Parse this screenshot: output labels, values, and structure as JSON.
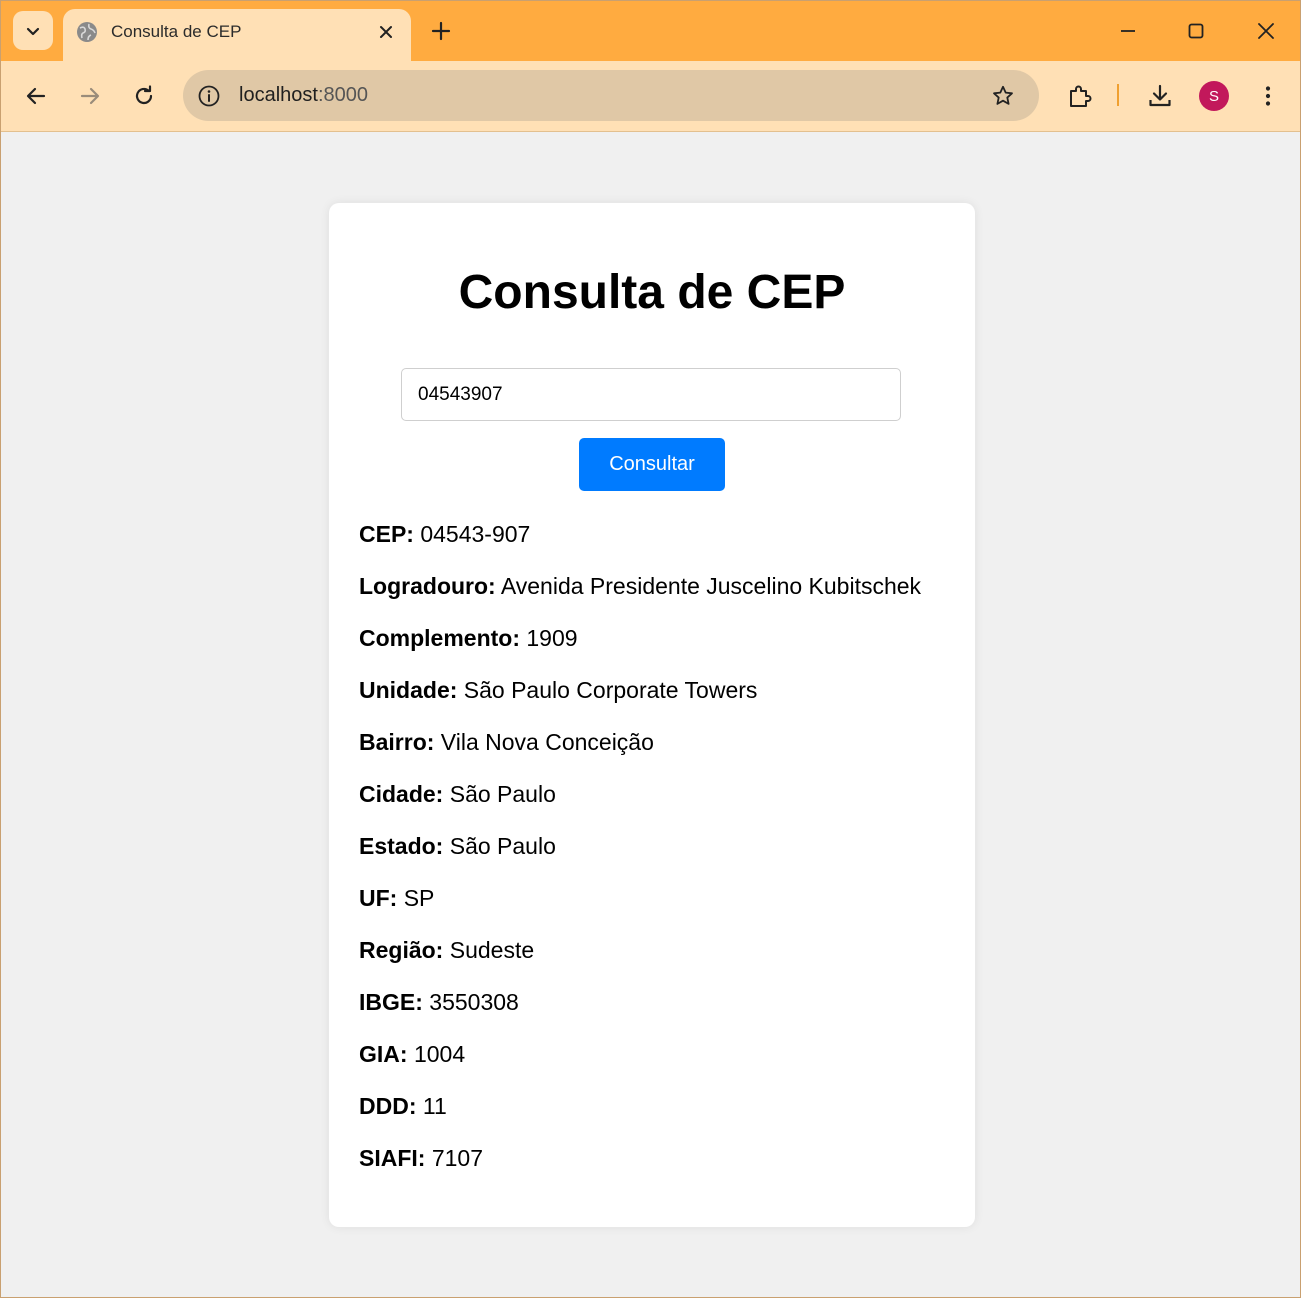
{
  "browser": {
    "tab": {
      "title": "Consulta de CEP"
    },
    "address_bar": {
      "host": "localhost",
      "port": ":8000"
    },
    "profile_initial": "S",
    "icons": {
      "tab_search": "chevron-down-icon",
      "favicon": "globe-icon",
      "tab_close": "close-icon",
      "new_tab": "plus-icon",
      "minimize": "minimize-icon",
      "maximize": "maximize-icon",
      "close_window": "close-icon",
      "back": "arrow-left-icon",
      "forward": "arrow-right-icon",
      "reload": "reload-icon",
      "site_info": "info-icon",
      "bookmark": "star-icon",
      "extensions": "puzzle-icon",
      "downloads": "download-icon",
      "menu": "kebab-menu-icon"
    },
    "colors": {
      "tabstrip": "#ffab40",
      "toolbar": "#ffe0b5",
      "omnibox": "#e0c8a6",
      "avatar": "#c2185b"
    }
  },
  "page": {
    "heading": "Consulta de CEP",
    "cep_input": {
      "value": "04543907"
    },
    "submit_label": "Consultar",
    "colors": {
      "button": "#007bff",
      "background": "#f0f0f0",
      "card": "#ffffff"
    },
    "results": [
      {
        "label": "CEP:",
        "value": "04543-907"
      },
      {
        "label": "Logradouro:",
        "value": "Avenida Presidente Juscelino Kubitschek"
      },
      {
        "label": "Complemento:",
        "value": "1909"
      },
      {
        "label": "Unidade:",
        "value": "São Paulo Corporate Towers"
      },
      {
        "label": "Bairro:",
        "value": "Vila Nova Conceição"
      },
      {
        "label": "Cidade:",
        "value": "São Paulo"
      },
      {
        "label": "Estado:",
        "value": "São Paulo"
      },
      {
        "label": "UF:",
        "value": "SP"
      },
      {
        "label": "Região:",
        "value": "Sudeste"
      },
      {
        "label": "IBGE:",
        "value": "3550308"
      },
      {
        "label": "GIA:",
        "value": "1004"
      },
      {
        "label": "DDD:",
        "value": "11"
      },
      {
        "label": "SIAFI:",
        "value": "7107"
      }
    ]
  }
}
